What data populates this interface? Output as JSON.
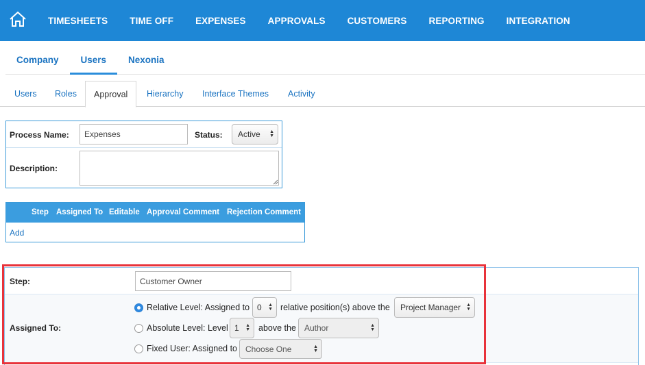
{
  "nav": {
    "items": [
      "TIMESHEETS",
      "TIME OFF",
      "EXPENSES",
      "APPROVALS",
      "CUSTOMERS",
      "REPORTING",
      "INTEGRATION"
    ],
    "home_icon": "home-icon",
    "background": "#1e87d6"
  },
  "primary_tabs": {
    "items": [
      "Company",
      "Users",
      "Nexonia"
    ],
    "active": "Users"
  },
  "secondary_tabs": {
    "items": [
      "Users",
      "Roles",
      "Approval",
      "Hierarchy",
      "Interface Themes",
      "Activity"
    ],
    "active": "Approval"
  },
  "process": {
    "name_label": "Process Name:",
    "name_value": "Expenses",
    "status_label": "Status:",
    "status_value": "Active",
    "description_label": "Description:",
    "description_value": ""
  },
  "steps_table": {
    "columns": [
      "Step",
      "Assigned To",
      "Editable",
      "Approval Comment",
      "Rejection Comment"
    ],
    "add_label": "Add"
  },
  "step_editor": {
    "step_label": "Step:",
    "step_value": "Customer Owner",
    "assigned_label": "Assigned To:",
    "relative": {
      "prefix": "Relative Level: Assigned to",
      "value": "0",
      "middle": "relative position(s) above the",
      "role": "Project Manager",
      "checked": true
    },
    "absolute": {
      "prefix": "Absolute Level: Level",
      "value": "1",
      "middle": "above the",
      "role": "Author",
      "checked": false
    },
    "fixed": {
      "prefix": "Fixed User: Assigned to",
      "user": "Choose One",
      "checked": false
    }
  },
  "colors": {
    "accent": "#1e87d6",
    "link": "#1a73c1",
    "table_header": "#3b9ddf",
    "highlight": "#e8323a"
  }
}
